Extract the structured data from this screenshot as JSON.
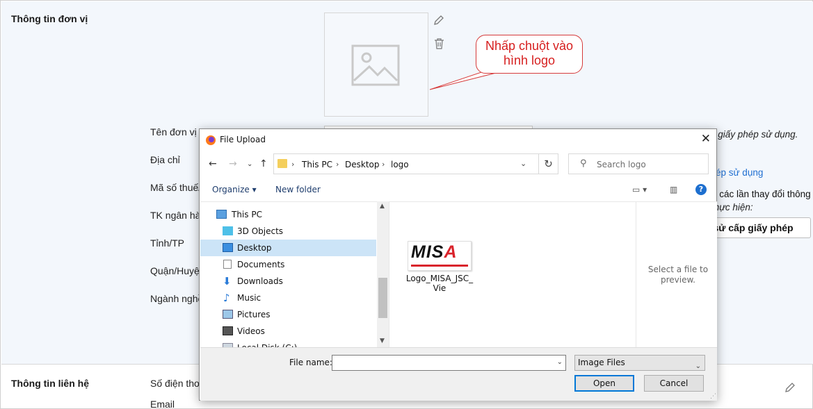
{
  "page": {
    "section_unit_title": "Thông tin đơn vị",
    "section_contact_title": "Thông tin liên hệ",
    "fields": [
      "Tên đơn vị",
      "Địa chỉ",
      "Mã số thuế/",
      "TK ngân hà",
      "Tỉnh/TP",
      "Quận/Huyệ",
      "Ngành nghề"
    ],
    "contact_fields": [
      "Số điện thoạ",
      "Email"
    ],
    "right_text_1": "n giấy phép sử dụng.",
    "right_link": "ép sử dụng",
    "right_text_2": "o các lần thay đổi thông",
    "right_text_3": "thực hiện:",
    "right_button": "h sử cấp giấy phép"
  },
  "callout": {
    "line1": "Nhấp chuột vào",
    "line2": "hình logo"
  },
  "dialog": {
    "title": "File Upload",
    "close": "✕",
    "breadcrumbs": [
      "This PC",
      "Desktop",
      "logo"
    ],
    "search_placeholder": "Search logo",
    "organize_label": "Organize ▾",
    "new_folder_label": "New folder",
    "help_label": "?",
    "tree": [
      {
        "label": "This PC",
        "icon": "pc-icon"
      },
      {
        "label": "3D Objects",
        "icon": "cube-icon"
      },
      {
        "label": "Desktop",
        "icon": "desktop-icon",
        "selected": true
      },
      {
        "label": "Documents",
        "icon": "document-icon"
      },
      {
        "label": "Downloads",
        "icon": "download-icon"
      },
      {
        "label": "Music",
        "icon": "music-icon"
      },
      {
        "label": "Pictures",
        "icon": "pictures-icon"
      },
      {
        "label": "Videos",
        "icon": "videos-icon"
      },
      {
        "label": "Local Disk (C:)",
        "icon": "disk-icon"
      }
    ],
    "file": {
      "name_line1": "Logo_MISA_JSC_",
      "name_line2": "Vie",
      "logo_text": "MISA"
    },
    "preview_text": "Select a file to preview.",
    "file_name_label": "File name:",
    "file_name_value": "",
    "file_type": "Image Files",
    "open_label": "Open",
    "cancel_label": "Cancel"
  },
  "colors": {
    "accent": "#0078d7",
    "callout": "#d61f1f",
    "link": "#1f6fd1"
  }
}
